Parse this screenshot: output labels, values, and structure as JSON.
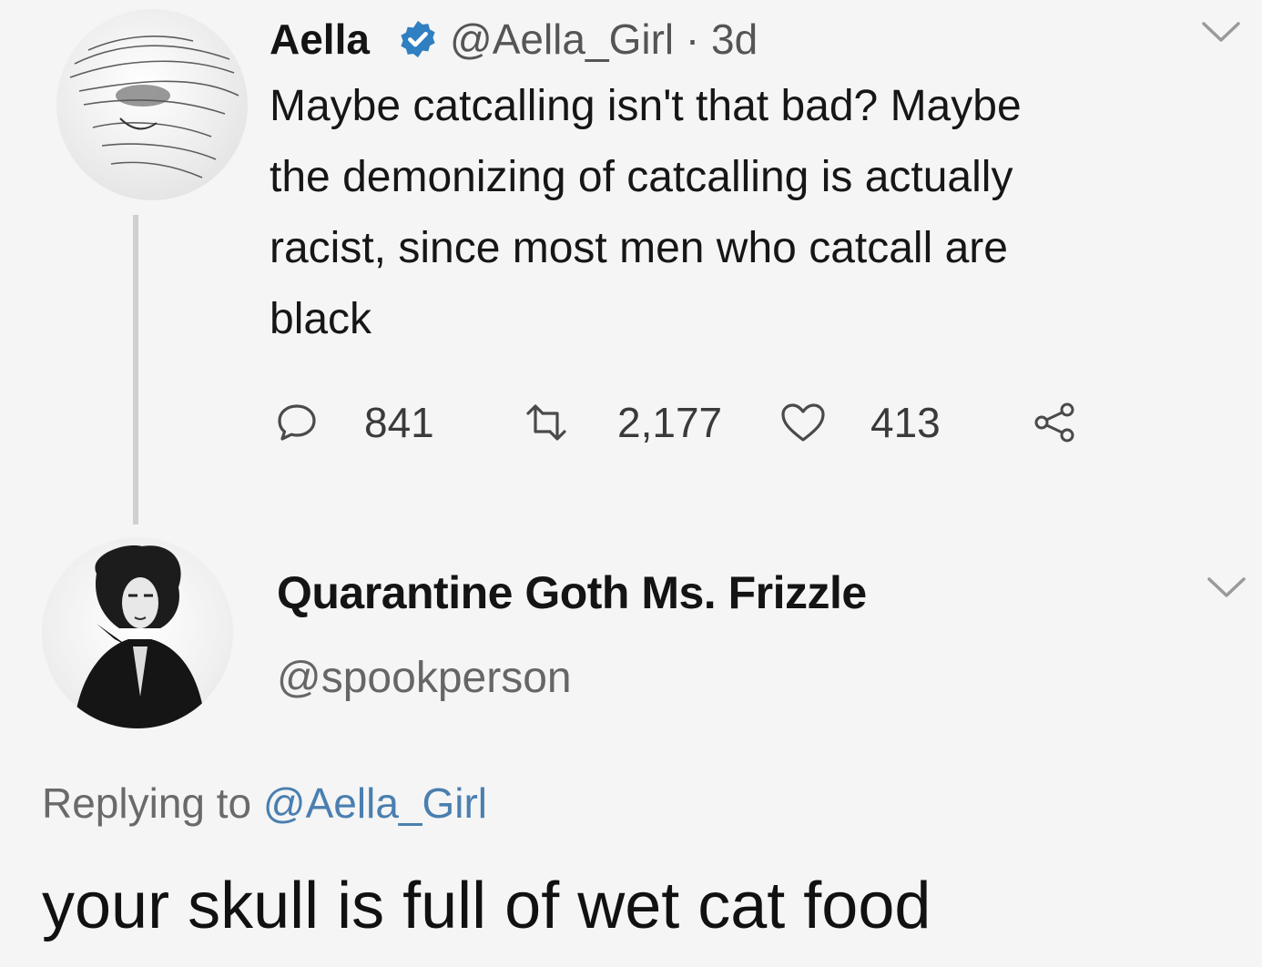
{
  "tweet": {
    "author_name": "Aella",
    "author_handle": "@Aella_Girl · 3d",
    "text": "Maybe catcalling isn't that bad? Maybe the demonizing of catcalling is actually racist, since most men who catcall are black",
    "text_lines": [
      "Maybe catcalling isn't that bad? Maybe",
      "the demonizing of catcalling is actually",
      "racist, since most men who catcall are",
      "black"
    ],
    "replies": "841",
    "retweets": "2,177",
    "likes": "413",
    "icons": [
      "reply-icon",
      "retweet-icon",
      "like-icon",
      "share-icon",
      "verified-badge-icon",
      "chevron-down-icon"
    ]
  },
  "reply": {
    "author_name": "Quarantine Goth Ms. Frizzle",
    "author_handle": "@spookperson",
    "replying_to_prefix": "Replying to ",
    "replying_to_handle": "@Aella_Girl",
    "text": "your skull is full of wet cat food"
  },
  "colors": {
    "background": "#f5f5f5",
    "verified": "#2f7fc1",
    "mention": "#4a7fb0"
  }
}
